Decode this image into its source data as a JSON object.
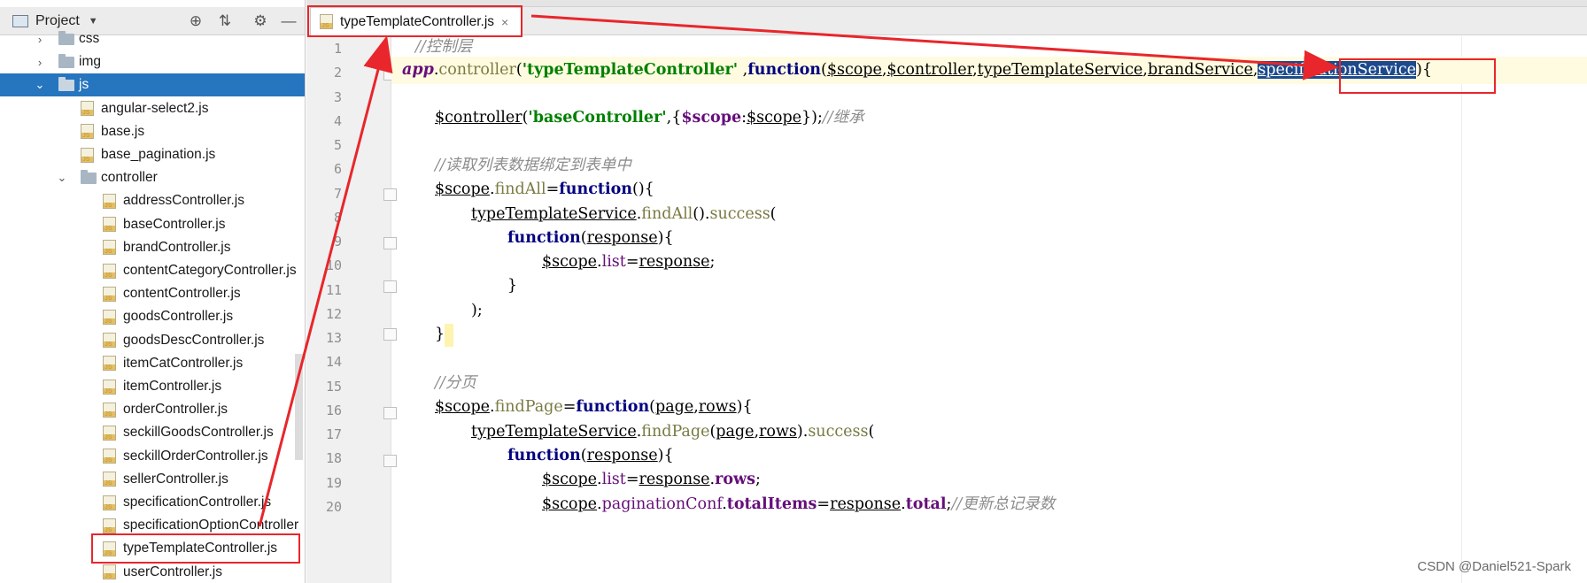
{
  "project_panel": {
    "title": "Project",
    "items": [
      {
        "label": "css",
        "type": "folder",
        "depth": 1,
        "expanded": false
      },
      {
        "label": "img",
        "type": "folder",
        "depth": 1,
        "expanded": false
      },
      {
        "label": "js",
        "type": "folder",
        "depth": 1,
        "expanded": true,
        "selected": true
      },
      {
        "label": "angular-select2.js",
        "type": "file",
        "depth": 2
      },
      {
        "label": "base.js",
        "type": "file",
        "depth": 2
      },
      {
        "label": "base_pagination.js",
        "type": "file",
        "depth": 2
      },
      {
        "label": "controller",
        "type": "folder",
        "depth": 2,
        "expanded": true
      },
      {
        "label": "addressController.js",
        "type": "file",
        "depth": 3
      },
      {
        "label": "baseController.js",
        "type": "file",
        "depth": 3
      },
      {
        "label": "brandController.js",
        "type": "file",
        "depth": 3
      },
      {
        "label": "contentCategoryController.js",
        "type": "file",
        "depth": 3
      },
      {
        "label": "contentController.js",
        "type": "file",
        "depth": 3
      },
      {
        "label": "goodsController.js",
        "type": "file",
        "depth": 3
      },
      {
        "label": "goodsDescController.js",
        "type": "file",
        "depth": 3
      },
      {
        "label": "itemCatController.js",
        "type": "file",
        "depth": 3
      },
      {
        "label": "itemController.js",
        "type": "file",
        "depth": 3
      },
      {
        "label": "orderController.js",
        "type": "file",
        "depth": 3
      },
      {
        "label": "seckillGoodsController.js",
        "type": "file",
        "depth": 3
      },
      {
        "label": "seckillOrderController.js",
        "type": "file",
        "depth": 3
      },
      {
        "label": "sellerController.js",
        "type": "file",
        "depth": 3
      },
      {
        "label": "specificationController.js",
        "type": "file",
        "depth": 3
      },
      {
        "label": "specificationOptionController",
        "type": "file",
        "depth": 3
      },
      {
        "label": "typeTemplateController.js",
        "type": "file",
        "depth": 3
      },
      {
        "label": "userController.js",
        "type": "file",
        "depth": 3
      }
    ]
  },
  "editor": {
    "tab_label": "typeTemplateController.js",
    "tab_close": "×",
    "line_numbers": [
      "1",
      "2",
      "3",
      "4",
      "5",
      "6",
      "7",
      "8",
      "9",
      "10",
      "11",
      "12",
      "13",
      "14",
      "15",
      "16",
      "17",
      "18",
      "19",
      "20"
    ],
    "code": {
      "l1_comment": "//控制层",
      "l2_app": "app",
      "l2_dot": ".",
      "l2_controller": "controller",
      "l2_paren": "(",
      "l2_str": "'typeTemplateController'",
      "l2_comma": " ,",
      "l2_function": "function",
      "l2_open": "(",
      "l2_p1": "$scope",
      "l2_c1": ",",
      "l2_p2": "$controller",
      "l2_c2": ",",
      "l2_p3": "typeTemplateService",
      "l2_c3": ",",
      "l2_p4": "brandService",
      "l2_c4": ",",
      "l2_p5": "specificationService",
      "l2_close": "){",
      "l4_controller": "$controller",
      "l4_open": "(",
      "l4_str": "'baseController'",
      "l4_comma": ",{",
      "l4_key": "$scope",
      "l4_colon": ":",
      "l4_val": "$scope",
      "l4_close": "});",
      "l4_comment": "//继承",
      "l6_comment": "//读取列表数据绑定到表单中",
      "l7_scope": "$scope",
      "l7_dot": ".",
      "l7_findall": "findAll",
      "l7_eq": "=",
      "l7_function": "function",
      "l7_rest": "(){",
      "l8_service": "typeTemplateService",
      "l8_dot": ".",
      "l8_findall": "findAll",
      "l8_mid": "().",
      "l8_success": "success",
      "l8_open": "(",
      "l9_function": "function",
      "l9_open": "(",
      "l9_param": "response",
      "l9_close": "){",
      "l10_scope": "$scope",
      "l10_dot": ".",
      "l10_list": "list",
      "l10_eq": "=",
      "l10_resp": "response",
      "l10_semi": ";",
      "l11_brace": "}",
      "l12_close": ");",
      "l13_brace": "}",
      "l15_comment": "//分页",
      "l16_scope": "$scope",
      "l16_dot": ".",
      "l16_findpage": "findPage",
      "l16_eq": "=",
      "l16_function": "function",
      "l16_open": "(",
      "l16_page": "page",
      "l16_comma": ",",
      "l16_rows": "rows",
      "l16_close": "){",
      "l17_service": "typeTemplateService",
      "l17_dot": ".",
      "l17_findpage": "findPage",
      "l17_open": "(",
      "l17_page": "page",
      "l17_comma": ",",
      "l17_rows": "rows",
      "l17_mid": ").",
      "l17_success": "success",
      "l17_paren": "(",
      "l18_function": "function",
      "l18_open": "(",
      "l18_param": "response",
      "l18_close": "){",
      "l19_scope": "$scope",
      "l19_dot": ".",
      "l19_list": "list",
      "l19_eq": "=",
      "l19_resp": "response",
      "l19_dot2": ".",
      "l19_rows": "rows",
      "l19_semi": ";",
      "l20_scope": "$scope",
      "l20_dot": ".",
      "l20_pag": "paginationConf",
      "l20_dot2": ".",
      "l20_total": "totalItems",
      "l20_eq": "=",
      "l20_resp": "response",
      "l20_dot3": ".",
      "l20_totalf": "total",
      "l20_semi": ";",
      "l20_comment": "//更新总记录数"
    }
  },
  "watermark": "CSDN @Daniel521-Spark",
  "colors": {
    "selection": "#2675bf",
    "annotation": "#e8262b",
    "keyword": "#000080",
    "string": "#008000",
    "comment": "#8c8c8c"
  },
  "icons": [
    "project-icon",
    "target-icon",
    "collapse-icon",
    "gear-icon",
    "minimize-icon",
    "folder-icon",
    "js-file-icon",
    "close-icon"
  ]
}
